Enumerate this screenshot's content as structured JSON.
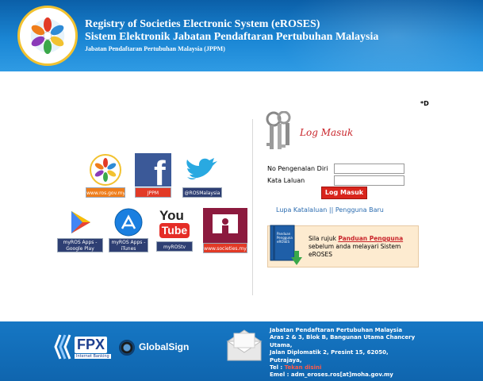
{
  "header": {
    "title_en": "Registry of Societies Electronic System (eROSES)",
    "title_ms": "Sistem Elektronik Jabatan Pendaftaran Pertubuhan Malaysia",
    "subtitle": "Jabatan Pendaftaran Pertubuhan Malaysia (JPPM)"
  },
  "marker": "*D",
  "social": {
    "ros_label": "www.ros.gov.my",
    "facebook_label": "JPPM",
    "twitter_label": "@ROSMalaysia",
    "googleplay_label": "myROS Apps - Google Play",
    "itunes_label": "myROS Apps - iTunes",
    "youtube_label": "myROStv",
    "youtube_logo_top": "You",
    "youtube_logo_bottom": "Tube",
    "societies_label": "www.societies.my"
  },
  "login": {
    "title": "Log Masuk",
    "id_label": "No Pengenalan Diri",
    "id_value": "",
    "password_label": "Kata Laluan",
    "password_value": "",
    "submit_label": "Log Masuk",
    "forgot_link": "Lupa Katalaluan",
    "separator": " || ",
    "new_user_link": "Pengguna Baru"
  },
  "help": {
    "book_title": "Panduan Pengguna eROSES",
    "text_before": "Sila rujuk ",
    "link": "Panduan Pengguna",
    "text_after": " sebelum anda melayari Sistem eROSES"
  },
  "footer": {
    "fpx_label": "FPX",
    "fpx_sub": "Internet Banking",
    "globalsign_label": "GlobalSign",
    "org_name": "Jabatan Pendaftaran Pertubuhan Malaysia",
    "address1": "Aras 2 & 3, Blok B, Bangunan Utama Chancery Utama,",
    "address2": "Jalan Diplomatik 2, Presint 15, 62050,",
    "address3": "Putrajaya,",
    "tel_label": "Tel : ",
    "tel_link": "Tekan disini",
    "email": "Emel : adm_eroses.ros[at]moha.gov.my"
  },
  "colors": {
    "header_blue": "#1a86d4",
    "accent_red": "#d9251c",
    "link_blue": "#2b6cb0"
  }
}
